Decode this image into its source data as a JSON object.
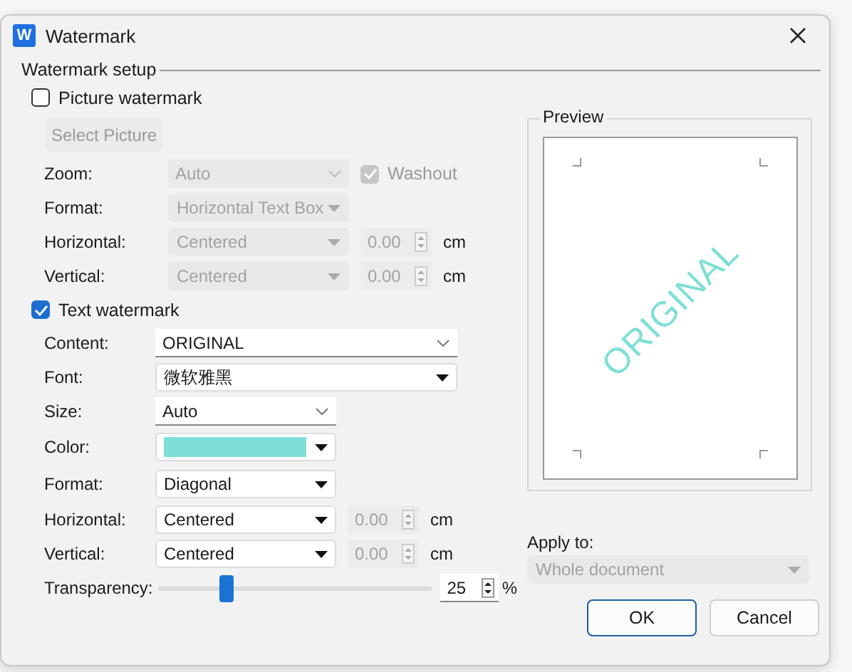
{
  "window": {
    "title": "Watermark",
    "app_badge": "W"
  },
  "setup": {
    "title": "Watermark setup"
  },
  "picture_watermark": {
    "label": "Picture watermark",
    "checked": false,
    "select_button": "Select Picture",
    "rows": [
      {
        "label": "Zoom:",
        "kind": "editable",
        "value": "Auto",
        "checkbox": {
          "label": "Washout",
          "checked": true
        }
      },
      {
        "label": "Format:",
        "kind": "list",
        "value": "Horizontal Text Box"
      },
      {
        "label": "Horizontal:",
        "kind": "list",
        "value": "Centered",
        "spinner": {
          "value": "0.00",
          "unit": "cm",
          "disabled": true
        }
      },
      {
        "label": "Vertical:",
        "kind": "list",
        "value": "Centered",
        "spinner": {
          "value": "0.00",
          "unit": "cm",
          "disabled": true
        }
      }
    ]
  },
  "text_watermark": {
    "label": "Text watermark",
    "checked": true,
    "rows": [
      {
        "label": "Content:",
        "kind": "editable",
        "value": "ORIGINAL"
      },
      {
        "label": "Font:",
        "kind": "list",
        "value": "微软雅黑"
      },
      {
        "label": "Size:",
        "kind": "editable",
        "value": "Auto"
      },
      {
        "label": "Color:",
        "kind": "color",
        "color": "#7fdfd6"
      },
      {
        "label": "Format:",
        "kind": "list",
        "value": "Diagonal"
      },
      {
        "label": "Horizontal:",
        "kind": "list",
        "value": "Centered",
        "spinner": {
          "value": "0.00",
          "unit": "cm",
          "disabled": true
        }
      },
      {
        "label": "Vertical:",
        "kind": "list",
        "value": "Centered",
        "spinner": {
          "value": "0.00",
          "unit": "cm",
          "disabled": true
        }
      }
    ],
    "transparency": {
      "label": "Transparency:",
      "level": 0.25,
      "reading": "25",
      "unit": "%"
    }
  },
  "preview": {
    "title": "Preview",
    "text": "ORIGINAL"
  },
  "apply_to": {
    "label": "Apply to:",
    "value": "Whole document",
    "disabled": true
  },
  "buttons": [
    {
      "label": "OK",
      "default": true
    },
    {
      "label": "Cancel",
      "default": false
    }
  ]
}
